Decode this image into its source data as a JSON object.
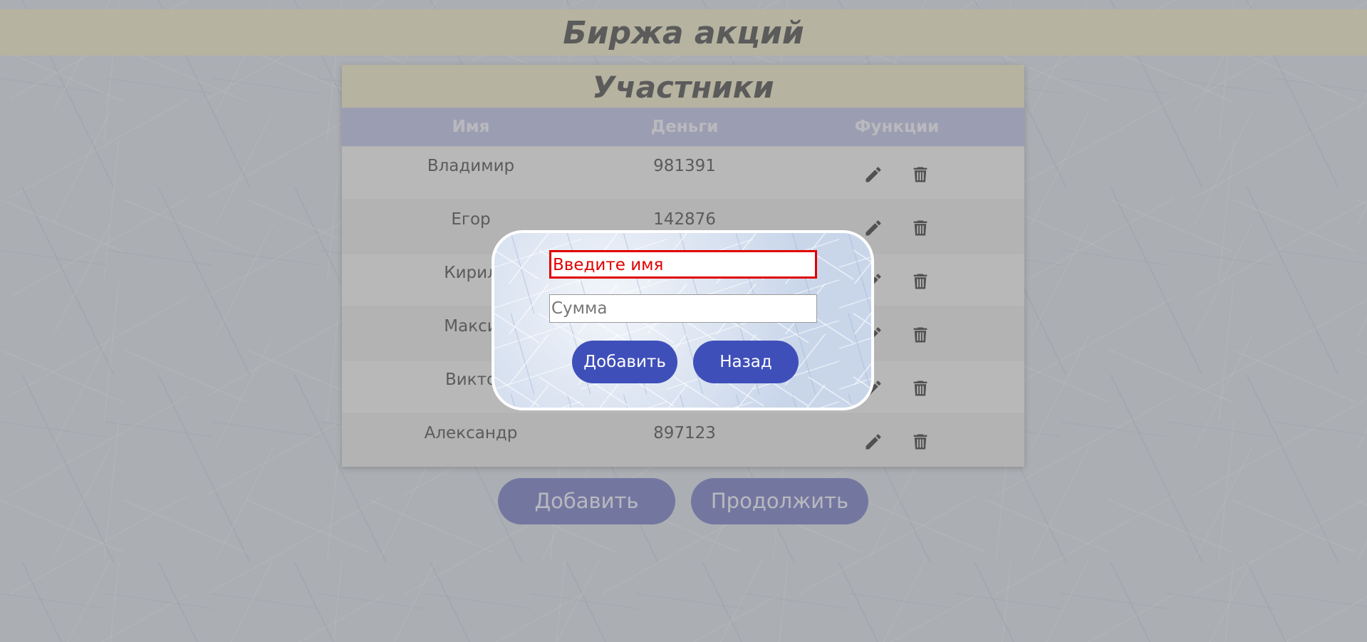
{
  "header": {
    "title": "Биржа акций"
  },
  "panel": {
    "title": "Участники",
    "columns": [
      "Имя",
      "Деньги",
      "Функции"
    ],
    "rows": [
      {
        "name": "Владимир",
        "money": "981391"
      },
      {
        "name": "Егор",
        "money": "142876"
      },
      {
        "name": "Кирил",
        "money": ""
      },
      {
        "name": "Макси",
        "money": ""
      },
      {
        "name": "Викто",
        "money": ""
      },
      {
        "name": "Александр",
        "money": "897123"
      }
    ],
    "row_icons": [
      "pencil-icon",
      "trash-icon"
    ]
  },
  "actions": {
    "add_label": "Добавить",
    "continue_label": "Продолжить"
  },
  "modal": {
    "name_input": {
      "value": "Введите имя",
      "error": true
    },
    "sum_input": {
      "placeholder": "Сумма"
    },
    "add_label": "Добавить",
    "back_label": "Назад"
  },
  "colors": {
    "header_bg": "#f2eccc",
    "table_header_bg": "#c3c8ea",
    "modal_button": "#3f4fb9",
    "error": "#e00000"
  }
}
